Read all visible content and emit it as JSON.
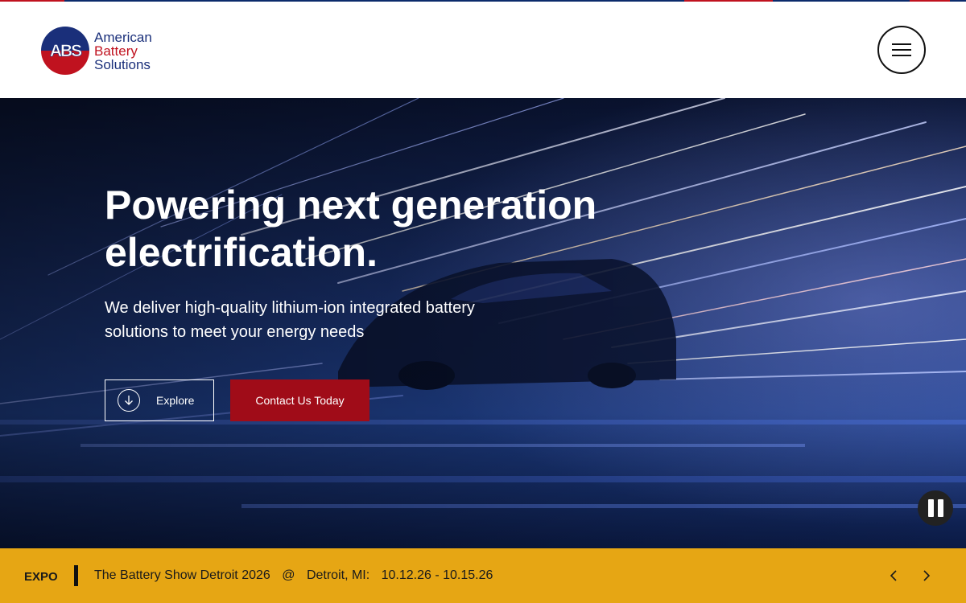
{
  "brand": {
    "logo_letters": "ABS",
    "line1": "American",
    "line2": "Battery",
    "line3": "Solutions"
  },
  "hero": {
    "title_line1": "Powering next generation",
    "title_line2": "electrification.",
    "subtitle": "We deliver high-quality lithium-ion integrated battery solutions to meet your energy needs",
    "explore_label": "Explore",
    "contact_label": "Contact Us Today"
  },
  "ticker": {
    "tag": "EXPO",
    "event": "The Battery Show Detroit 2026",
    "at": "@",
    "location": "Detroit, MI:",
    "dates": "10.12.26 - 10.15.26"
  },
  "icons": {
    "menu": "hamburger-icon",
    "explore": "arrow-down-circle-icon",
    "pause": "pause-icon",
    "prev": "chevron-left-icon",
    "next": "chevron-right-icon"
  },
  "colors": {
    "brand_blue": "#1a2f7a",
    "brand_red": "#c0121f",
    "cta_red": "#a00c18",
    "ticker_bg": "#e6a614"
  }
}
